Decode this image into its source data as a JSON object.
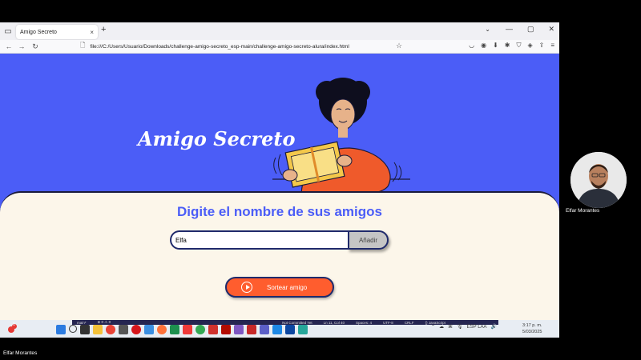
{
  "browser": {
    "tab_title": "Amigo Secreto",
    "tab_close": "×",
    "new_tab": "+",
    "url": "file:///C:/Users/Usuario/Downloads/challenge-amigo-secreto_esp-main/challenge-amigo-secreto-alura/index.html",
    "window_controls": [
      "—",
      "▢",
      "✕"
    ],
    "nav_back": "←",
    "nav_forward": "→",
    "nav_reload": "↻",
    "star": "☆"
  },
  "page": {
    "hero_title": "Amigo Secreto",
    "panel_title": "Digite el nombre de sus amigos",
    "input_value": "Elfa",
    "add_button": "Añadir",
    "draw_button": "Sortear amigo",
    "colors": {
      "hero_bg": "#4b5df7",
      "panel_bg": "#fcf6ea",
      "title_color": "#4b5df7",
      "draw_button_bg": "#ff5d2e",
      "add_button_bg": "#c5c5c5"
    }
  },
  "statusbar": {
    "items": [
      "main*",
      "⊗ 0 ⚠ 0",
      "Not Committed Yet",
      "Ln 11, Col 40",
      "Spaces: 4",
      "UTF-8",
      "CRLF",
      "{} JavaScript"
    ]
  },
  "taskbar": {
    "time": "3:17 p. m.",
    "date": "5/03/2025",
    "lang": "ESP LAA",
    "notification_badge": "1"
  },
  "meeting": {
    "participant_name": "Elfar Morantes",
    "self_name": "Elfar Morantes"
  }
}
